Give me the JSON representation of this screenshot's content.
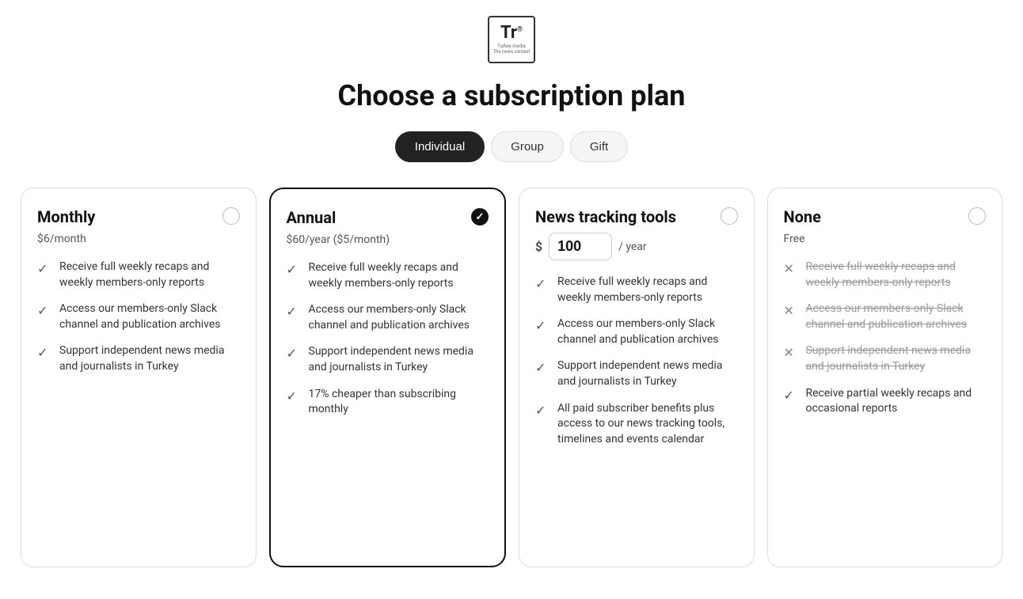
{
  "logo": {
    "tr": "Tr",
    "sup": "®",
    "sub": "Turkey media\nThe news context"
  },
  "page": {
    "title": "Choose a subscription plan"
  },
  "tabs": [
    {
      "id": "individual",
      "label": "Individual",
      "active": true
    },
    {
      "id": "group",
      "label": "Group",
      "active": false
    },
    {
      "id": "gift",
      "label": "Gift",
      "active": false
    }
  ],
  "plans": [
    {
      "id": "monthly",
      "name": "Monthly",
      "price": "$6/month",
      "price_input": null,
      "selected": false,
      "featured": false,
      "features": [
        {
          "text": "Receive full weekly recaps and weekly members-only reports",
          "included": true
        },
        {
          "text": "Access our members-only Slack channel and publication archives",
          "included": true
        },
        {
          "text": "Support independent news media and journalists in Turkey",
          "included": true
        }
      ]
    },
    {
      "id": "annual",
      "name": "Annual",
      "price": "$60/year ($5/month)",
      "price_input": null,
      "selected": true,
      "featured": true,
      "features": [
        {
          "text": "Receive full weekly recaps and weekly members-only reports",
          "included": true
        },
        {
          "text": "Access our members-only Slack channel and publication archives",
          "included": true
        },
        {
          "text": "Support independent news media and journalists in Turkey",
          "included": true
        },
        {
          "text": "17% cheaper than subscribing monthly",
          "included": true
        }
      ]
    },
    {
      "id": "news-tracking",
      "name": "News tracking tools",
      "price": null,
      "price_input": {
        "symbol": "$",
        "value": "100",
        "period": "/ year"
      },
      "selected": false,
      "featured": false,
      "features": [
        {
          "text": "Receive full weekly recaps and weekly members-only reports",
          "included": true
        },
        {
          "text": "Access our members-only Slack channel and publication archives",
          "included": true
        },
        {
          "text": "Support independent news media and journalists in Turkey",
          "included": true
        },
        {
          "text": "All paid subscriber benefits plus access to our news tracking tools, timelines and events calendar",
          "included": true
        }
      ]
    },
    {
      "id": "none",
      "name": "None",
      "price": "Free",
      "price_input": null,
      "selected": false,
      "featured": false,
      "features": [
        {
          "text": "Receive full weekly recaps and weekly members-only reports",
          "included": false
        },
        {
          "text": "Access our members-only Slack channel and publication archives",
          "included": false
        },
        {
          "text": "Support independent news media and journalists in Turkey",
          "included": false
        },
        {
          "text": "Receive partial weekly recaps and occasional reports",
          "included": true
        }
      ]
    }
  ]
}
